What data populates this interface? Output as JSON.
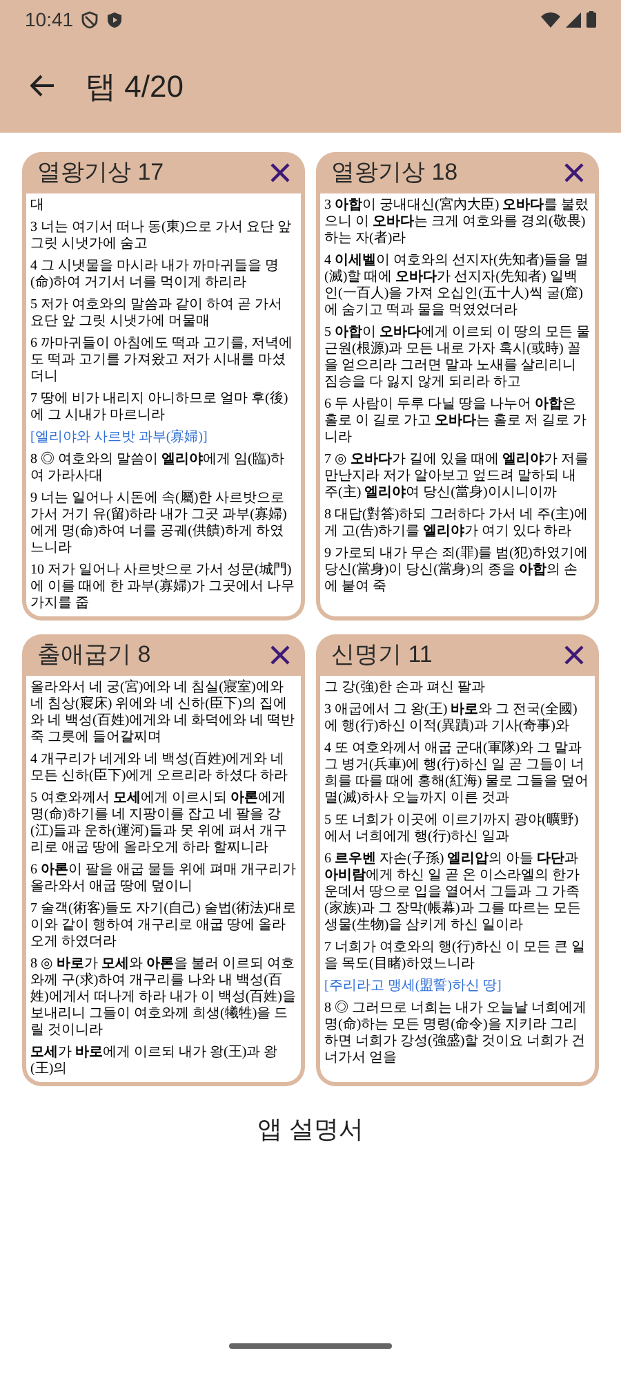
{
  "status_bar": {
    "time": "10:41"
  },
  "app_bar": {
    "title": "탭 4/20"
  },
  "tabs": [
    {
      "title": "열왕기상 17",
      "paragraphs": [
        {
          "kind": "verse",
          "text": "대"
        },
        {
          "kind": "verse",
          "text": "3 너는 여기서 떠나 동(東)으로 가서 요단 앞 그릿 시냇가에 숨고"
        },
        {
          "kind": "verse",
          "text": "4 그 시냇물을 마시라 내가 까마귀들을 명(命)하여 거기서 너를 먹이게 하리라"
        },
        {
          "kind": "verse",
          "text": "5 저가 여호와의 말씀과 같이 하여 곧 가서 요단 앞 그릿 시냇가에 머물매"
        },
        {
          "kind": "verse",
          "text": "6 까마귀들이 아침에도 떡과 고기를, 저녁에도 떡과 고기를 가져왔고 저가 시내를 마셨더니"
        },
        {
          "kind": "verse",
          "text": "7 땅에 비가 내리지 아니하므로 얼마 후(後)에 그 시내가 마르니라"
        },
        {
          "kind": "heading",
          "text": "[엘리야와 사르밧 과부(寡婦)]"
        },
        {
          "kind": "verse",
          "text": "8 ◎ 여호와의 말씀이 **엘리야**에게 임(臨)하여 가라사대"
        },
        {
          "kind": "verse",
          "text": "9 너는 일어나 시돈에 속(屬)한 사르밧으로 가서 거기 유(留)하라 내가 그곳 과부(寡婦)에게 명(命)하여 너를 공궤(供饋)하게 하였느니라"
        },
        {
          "kind": "verse",
          "text": "10 저가 일어나 사르밧으로 가서 성문(城門)에 이를 때에 한 과부(寡婦)가 그곳에서 나무가지를 줍"
        }
      ]
    },
    {
      "title": "열왕기상 18",
      "paragraphs": [
        {
          "kind": "verse",
          "text": "3 **아합**이 궁내대신(宮內大臣) **오바다**를 불렀으니 이 **오바다**는 크게 여호와를 경외(敬畏)하는 자(者)라"
        },
        {
          "kind": "verse",
          "text": "4 **이세벨**이 여호와의 선지자(先知者)들을 멸(滅)할 때에 **오바다**가 선지자(先知者) 일백인(一百人)을 가져 오십인(五十人)씩 굴(窟)에 숨기고 떡과 물을 먹였었더라"
        },
        {
          "kind": "verse",
          "text": "5 **아합**이 **오바다**에게 이르되 이 땅의 모든 물 근원(根源)과 모든 내로 가자 혹시(或時) 꼴을 얻으리라 그러면 말과 노새를 살리리니 짐승을 다 잃지 않게 되리라 하고"
        },
        {
          "kind": "verse",
          "text": "6 두 사람이 두루 다닐 땅을 나누어 **아합**은 홀로 이 길로 가고 **오바다**는 홀로 저 길로 가니라"
        },
        {
          "kind": "verse",
          "text": "7 ◎ **오바다**가 길에 있을 때에 **엘리야**가 저를 만난지라 저가 알아보고 엎드려 말하되 내 주(主) **엘리야**여 당신(當身)이시니이까"
        },
        {
          "kind": "verse",
          "text": "8 대답(對答)하되 그러하다 가서 네 주(主)에게 고(告)하기를 **엘리야**가 여기 있다 하라"
        },
        {
          "kind": "verse",
          "text": "9 가로되 내가 무슨 죄(罪)를 범(犯)하였기에 당신(當身)이 당신(當身)의 종을 **아합**의 손에 붙여 죽"
        }
      ]
    },
    {
      "title": "출애굽기 8",
      "paragraphs": [
        {
          "kind": "verse",
          "text": "올라와서 네 궁(宮)에와 네 침실(寢室)에와 네 침상(寢床) 위에와 네 신하(臣下)의 집에와 네 백성(百姓)에게와 네 화덕에와 네 떡반죽 그릇에 들어갈찌며"
        },
        {
          "kind": "verse",
          "text": "4 개구리가 네게와 네 백성(百姓)에게와 네 모든 신하(臣下)에게 오르리라 하셨다 하라"
        },
        {
          "kind": "verse",
          "text": "5 여호와께서 **모세**에게 이르시되 **아론**에게 명(命)하기를 네 지팡이를 잡고 네 팔을 강(江)들과 운하(運河)들과 못 위에 펴서 개구리로 애굽 땅에 올라오게 하라 할찌니라"
        },
        {
          "kind": "verse",
          "text": "6 **아론**이 팔을 애굽 물들 위에 펴매 개구리가 올라와서 애굽 땅에 덮이니"
        },
        {
          "kind": "verse",
          "text": "7 술객(術客)들도 자기(自己) 술법(術法)대로 이와 같이 행하여 개구리로 애굽 땅에 올라오게 하였더라"
        },
        {
          "kind": "verse",
          "text": "8 ◎ **바로**가 **모세**와 **아론**을 불러 이르되 여호와께 구(求)하여 개구리를 나와 내 백성(百姓)에게서 떠나게 하라 내가 이 백성(百姓)을 보내리니 그들이 여호와께 희생(犧牲)을 드릴 것이니라"
        },
        {
          "kind": "verse",
          "text": "**모세**가 **바로**에게 이르되 내가 왕(王)과 왕(王)의"
        }
      ]
    },
    {
      "title": "신명기 11",
      "paragraphs": [
        {
          "kind": "verse",
          "text": "그 강(強)한 손과 펴신 팔과"
        },
        {
          "kind": "verse",
          "text": "3 애굽에서 그 왕(王) **바로**와 그 전국(全國)에 행(行)하신 이적(異蹟)과 기사(奇事)와"
        },
        {
          "kind": "verse",
          "text": "4 또 여호와께서 애굽 군대(軍隊)와 그 말과 그 병거(兵車)에 행(行)하신 일 곧 그들이 너희를 따를 때에 홍해(紅海) 물로 그들을 덮어 멸(滅)하사 오늘까지 이른 것과"
        },
        {
          "kind": "verse",
          "text": "5 또 너희가 이곳에 이르기까지 광야(曠野)에서 너희에게 행(行)하신 일과"
        },
        {
          "kind": "verse",
          "text": "6 **르우벤** 자손(子孫) **엘리압**의 아들 **다단**과 **아비람**에게 하신 일 곧 온 이스라엘의 한가운데서 땅으로 입을 열어서 그들과 그 가족(家族)과 그 장막(帳幕)과 그를 따르는 모든 생물(生物)을 삼키게 하신 일이라"
        },
        {
          "kind": "verse",
          "text": "7 너희가 여호와의 행(行)하신 이 모든 큰 일을 목도(目睹)하였느니라"
        },
        {
          "kind": "heading",
          "text": "[주리라고 맹세(盟誓)하신 땅]"
        },
        {
          "kind": "verse",
          "text": "8 ◎ 그러므로 너희는 내가 오늘날 너희에게 명(命)하는 모든 명령(命令)을 지키라 그리하면 너희가 강성(強盛)할 것이요 너희가 건너가서 얻을"
        }
      ]
    }
  ],
  "footer_link": "앱 설명서"
}
